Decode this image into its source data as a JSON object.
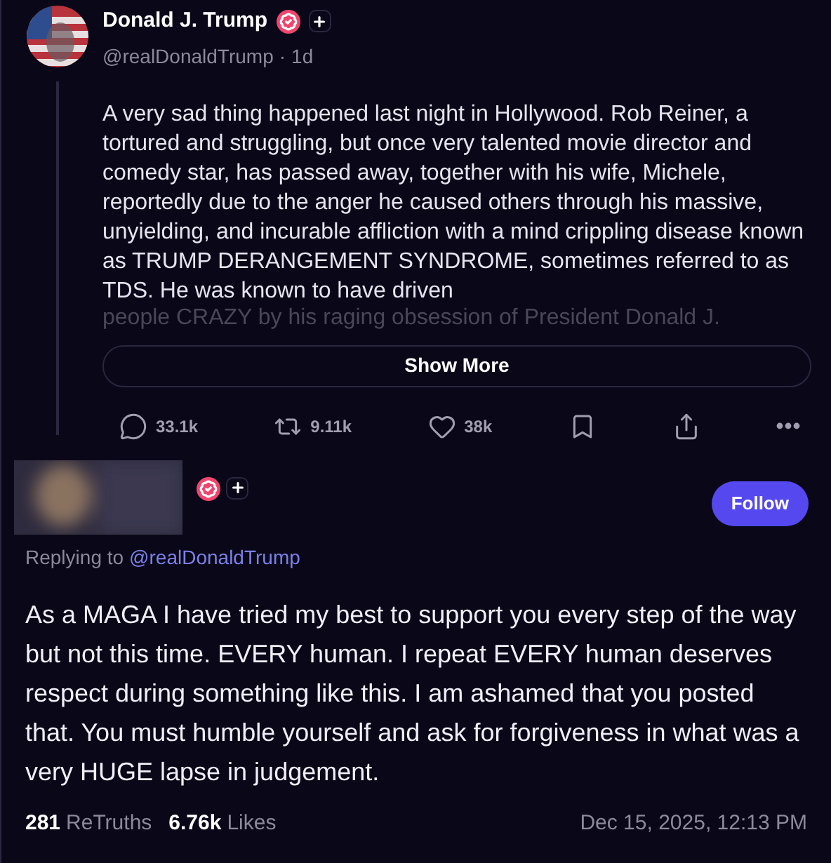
{
  "post": {
    "author": "Donald J. Trump",
    "verified": true,
    "handle": "@realDonaldTrump",
    "separator": "·",
    "time": "1d",
    "text": "A very sad thing happened last night in Hollywood. Rob Reiner, a tortured and struggling, but once very talented movie director and comedy star, has passed away, together with his wife, Michele, reportedly due to the anger he caused others through his massive, unyielding, and incurable affliction with a mind crippling disease known as TRUMP DERANGEMENT SYNDROME, sometimes referred to as TDS. He was known to have driven",
    "faded_text": "people CRAZY by his raging obsession of President Donald J.",
    "show_more": "Show More",
    "actions": [
      {
        "kind": "reply",
        "count": "33.1k"
      },
      {
        "kind": "retruth",
        "count": "9.11k"
      },
      {
        "kind": "like",
        "count": "38k"
      },
      {
        "kind": "bookmark"
      },
      {
        "kind": "share"
      },
      {
        "kind": "more"
      }
    ]
  },
  "reply": {
    "verified": true,
    "follow": "Follow",
    "replying_label": "Replying to",
    "replying_handle": "@realDonaldTrump",
    "text": "As a MAGA I have tried my best to support you every step of the way but not this time.  EVERY human.  I repeat EVERY human deserves respect during something like this.  I am ashamed that you posted that. You must humble yourself and ask for forgiveness in what was a very HUGE lapse in judgement.",
    "stats": [
      {
        "count": "281",
        "label": "ReTruths"
      },
      {
        "count": "6.76k",
        "label": "Likes"
      }
    ],
    "date": "Dec 15, 2025, 12:13 PM"
  }
}
